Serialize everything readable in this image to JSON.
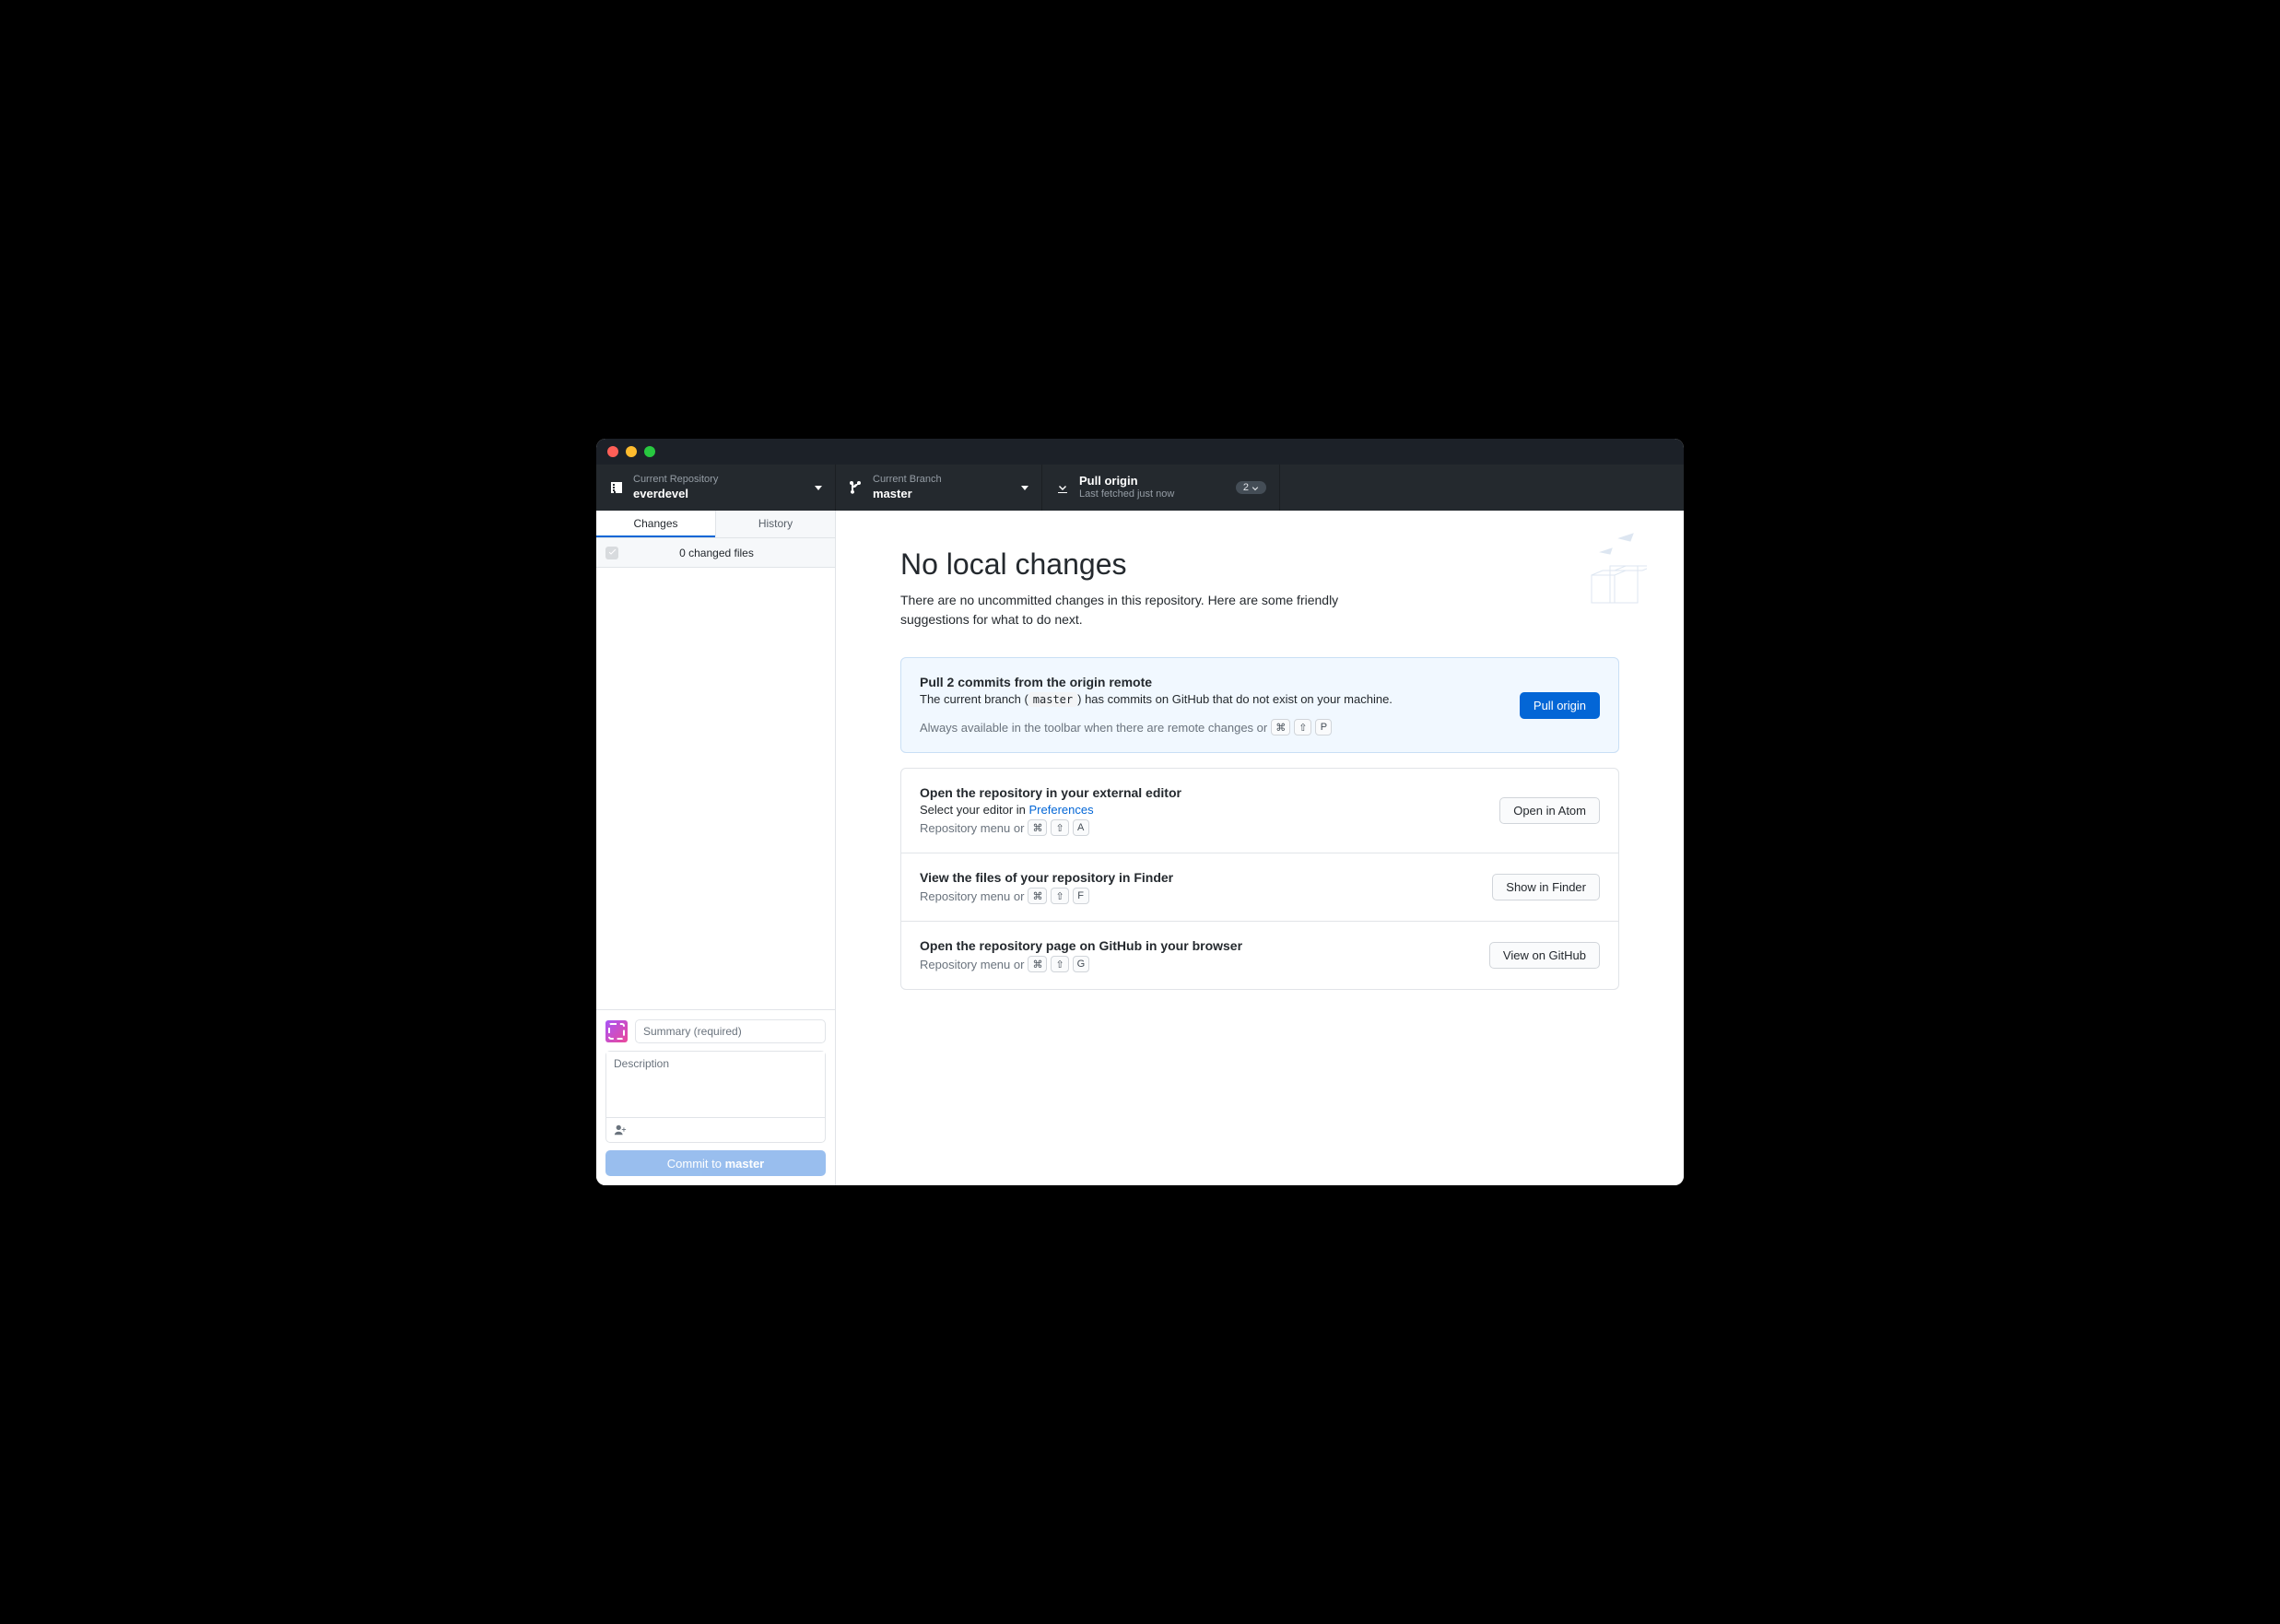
{
  "toolbar": {
    "repo": {
      "label": "Current Repository",
      "value": "everdevel"
    },
    "branch": {
      "label": "Current Branch",
      "value": "master"
    },
    "fetch": {
      "label": "Pull origin",
      "sub": "Last fetched just now",
      "badge_count": "2"
    }
  },
  "sidebar": {
    "tabs": {
      "changes": "Changes",
      "history": "History"
    },
    "files_header": "0 changed files",
    "summary_placeholder": "Summary (required)",
    "description_placeholder": "Description",
    "commit_prefix": "Commit to ",
    "commit_branch": "master"
  },
  "main": {
    "title": "No local changes",
    "subtitle": "There are no uncommitted changes in this repository. Here are some friendly suggestions for what to do next.",
    "cards": {
      "pull": {
        "title": "Pull 2 commits from the origin remote",
        "desc_pre": "The current branch (",
        "desc_code": "master",
        "desc_post": ") has commits on GitHub that do not exist on your machine.",
        "hint": "Always available in the toolbar when there are remote changes or",
        "keys": [
          "⌘",
          "⇧",
          "P"
        ],
        "button": "Pull origin"
      },
      "editor": {
        "title": "Open the repository in your external editor",
        "desc_pre": "Select your editor in ",
        "desc_link": "Preferences",
        "hint": "Repository menu or",
        "keys": [
          "⌘",
          "⇧",
          "A"
        ],
        "button": "Open in Atom"
      },
      "finder": {
        "title": "View the files of your repository in Finder",
        "hint": "Repository menu or",
        "keys": [
          "⌘",
          "⇧",
          "F"
        ],
        "button": "Show in Finder"
      },
      "github": {
        "title": "Open the repository page on GitHub in your browser",
        "hint": "Repository menu or",
        "keys": [
          "⌘",
          "⇧",
          "G"
        ],
        "button": "View on GitHub"
      }
    }
  }
}
